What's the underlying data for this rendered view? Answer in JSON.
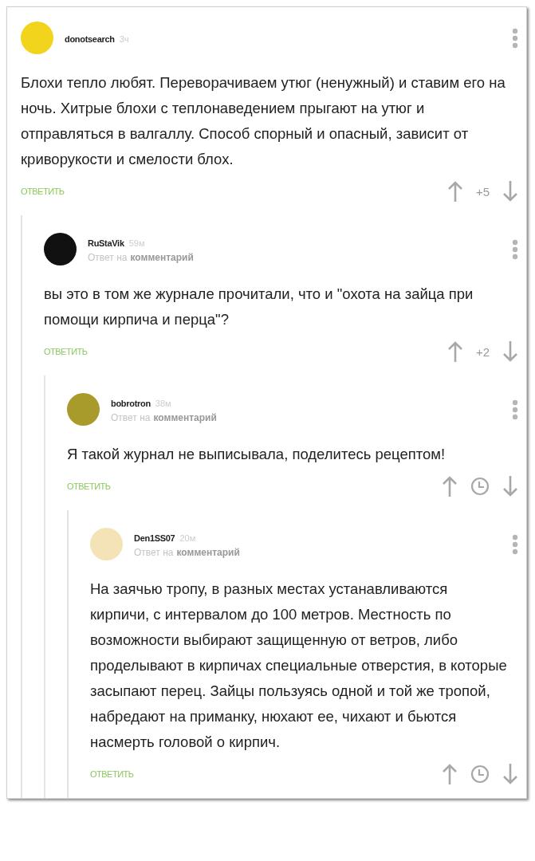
{
  "comments": [
    {
      "author": "donotsearch",
      "time": "3ч",
      "color": "#f2d41c",
      "text": "Блохи тепло любят. Переворачиваем утюг (ненужный) и ставим его на ночь. Хитрые блохи с теплонаведением прыгают на утюг и отправляться в валгаллу. Способ спорный и опасный, зависит от криворукости и смелости блох.",
      "reply": "ОТВЕТИТЬ",
      "kind": "number",
      "score": "+5",
      "children": [
        {
          "author": "RuStaVik",
          "time": "59м",
          "color": "#111111",
          "reply_to": {
            "prefix": "Ответ на",
            "link": "комментарий"
          },
          "text": "вы это в том же журнале прочитали, что и \"охота на зайца при помощи кирпича и перца\"?",
          "reply": "ОТВЕТИТЬ",
          "kind": "number",
          "score": "+2",
          "children": [
            {
              "author": "bobrotron",
              "time": "38м",
              "color": "#a99a2c",
              "reply_to": {
                "prefix": "Ответ на",
                "link": "комментарий"
              },
              "text": "Я такой журнал не выписывала, поделитесь рецептом!",
              "reply": "ОТВЕТИТЬ",
              "kind": "hidden",
              "children": [
                {
                  "author": "Den1SS07",
                  "time": "20м",
                  "color": "#f5e3b8",
                  "reply_to": {
                    "prefix": "Ответ на",
                    "link": "комментарий"
                  },
                  "text": "На заячью тропу, в разных местах устанавливаются кирпичи, с интервалом до 100 метров. Местность по возможности выбирают защищенную от ветров, либо проделывают в кирпичах специальные отверстия, в которые засыпают перец. Зайцы пользуясь одной и той же тропой, набредают на приманку, нюхают ее, чихают и бьются насмерть головой о кирпич.",
                  "reply": "ОТВЕТИТЬ",
                  "kind": "hidden"
                }
              ]
            }
          ]
        }
      ]
    }
  ]
}
